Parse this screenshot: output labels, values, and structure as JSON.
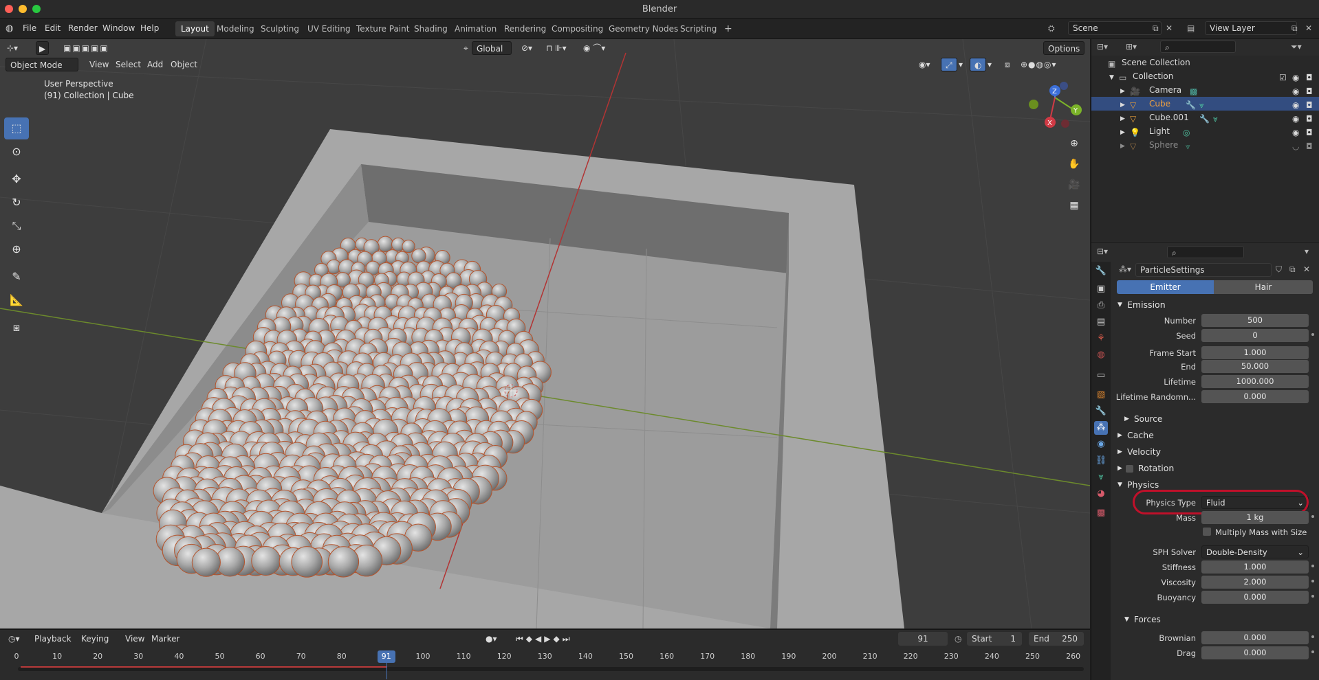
{
  "window": {
    "title": "Blender"
  },
  "menus": [
    "File",
    "Edit",
    "Render",
    "Window",
    "Help"
  ],
  "workspaces": [
    {
      "label": "Layout",
      "active": true
    },
    {
      "label": "Modeling"
    },
    {
      "label": "Sculpting"
    },
    {
      "label": "UV Editing"
    },
    {
      "label": "Texture Paint"
    },
    {
      "label": "Shading"
    },
    {
      "label": "Animation"
    },
    {
      "label": "Rendering"
    },
    {
      "label": "Compositing"
    },
    {
      "label": "Geometry Nodes"
    },
    {
      "label": "Scripting"
    }
  ],
  "add_workspace": "+",
  "scene": {
    "name": "Scene",
    "view_layer": "View Layer"
  },
  "viewport_header": {
    "mode": "Object Mode",
    "menus": [
      "View",
      "Select",
      "Add",
      "Object"
    ],
    "orientation": "Global",
    "options": "Options"
  },
  "viewport": {
    "info_line1": "User Perspective",
    "info_line2": "(91) Collection | Cube",
    "gizmo": {
      "x": "X",
      "y": "Y",
      "z": "Z"
    }
  },
  "outliner": {
    "scene_collection": "Scene Collection",
    "collection": "Collection",
    "items": [
      {
        "name": "Camera",
        "type": "camera",
        "selected": false
      },
      {
        "name": "Cube",
        "type": "mesh",
        "selected": true
      },
      {
        "name": "Cube.001",
        "type": "mesh",
        "selected": false
      },
      {
        "name": "Light",
        "type": "light",
        "selected": false
      },
      {
        "name": "Sphere",
        "type": "mesh",
        "selected": false,
        "hidden": true
      }
    ]
  },
  "properties": {
    "datablock": "ParticleSettings",
    "type_tabs": [
      "Emitter",
      "Hair"
    ],
    "active_type": "Emitter",
    "emission": {
      "title": "Emission",
      "number_label": "Number",
      "number": "500",
      "seed_label": "Seed",
      "seed": "0",
      "frame_start_label": "Frame Start",
      "frame_start": "1.000",
      "end_label": "End",
      "end": "50.000",
      "lifetime_label": "Lifetime",
      "lifetime": "1000.000",
      "lifetime_random_label": "Lifetime Randomn...",
      "lifetime_random": "0.000",
      "source": "Source"
    },
    "cache": "Cache",
    "velocity": "Velocity",
    "rotation": "Rotation",
    "physics": {
      "title": "Physics",
      "type_label": "Physics Type",
      "type": "Fluid",
      "mass_label": "Mass",
      "mass": "1 kg",
      "multiply_mass": "Multiply Mass with Size",
      "solver_label": "SPH Solver",
      "solver": "Double-Density",
      "stiffness_label": "Stiffness",
      "stiffness": "1.000",
      "viscosity_label": "Viscosity",
      "viscosity": "2.000",
      "buoyancy_label": "Buoyancy",
      "buoyancy": "0.000",
      "forces": "Forces",
      "brownian_label": "Brownian",
      "brownian": "0.000",
      "drag_label": "Drag",
      "drag": "0.000"
    },
    "highlight_color": "#c0102a"
  },
  "timeline": {
    "menus": [
      "Playback",
      "Keying",
      "View",
      "Marker"
    ],
    "current_frame": "91",
    "start_label": "Start",
    "start": "1",
    "end_label": "End",
    "end": "250",
    "ticks": [
      "0",
      "10",
      "20",
      "30",
      "40",
      "50",
      "60",
      "70",
      "80",
      "90",
      "100",
      "110",
      "120",
      "130",
      "140",
      "150",
      "160",
      "170",
      "180",
      "190",
      "200",
      "210",
      "220",
      "230",
      "240",
      "250",
      "260"
    ],
    "playhead_frame": 91
  }
}
